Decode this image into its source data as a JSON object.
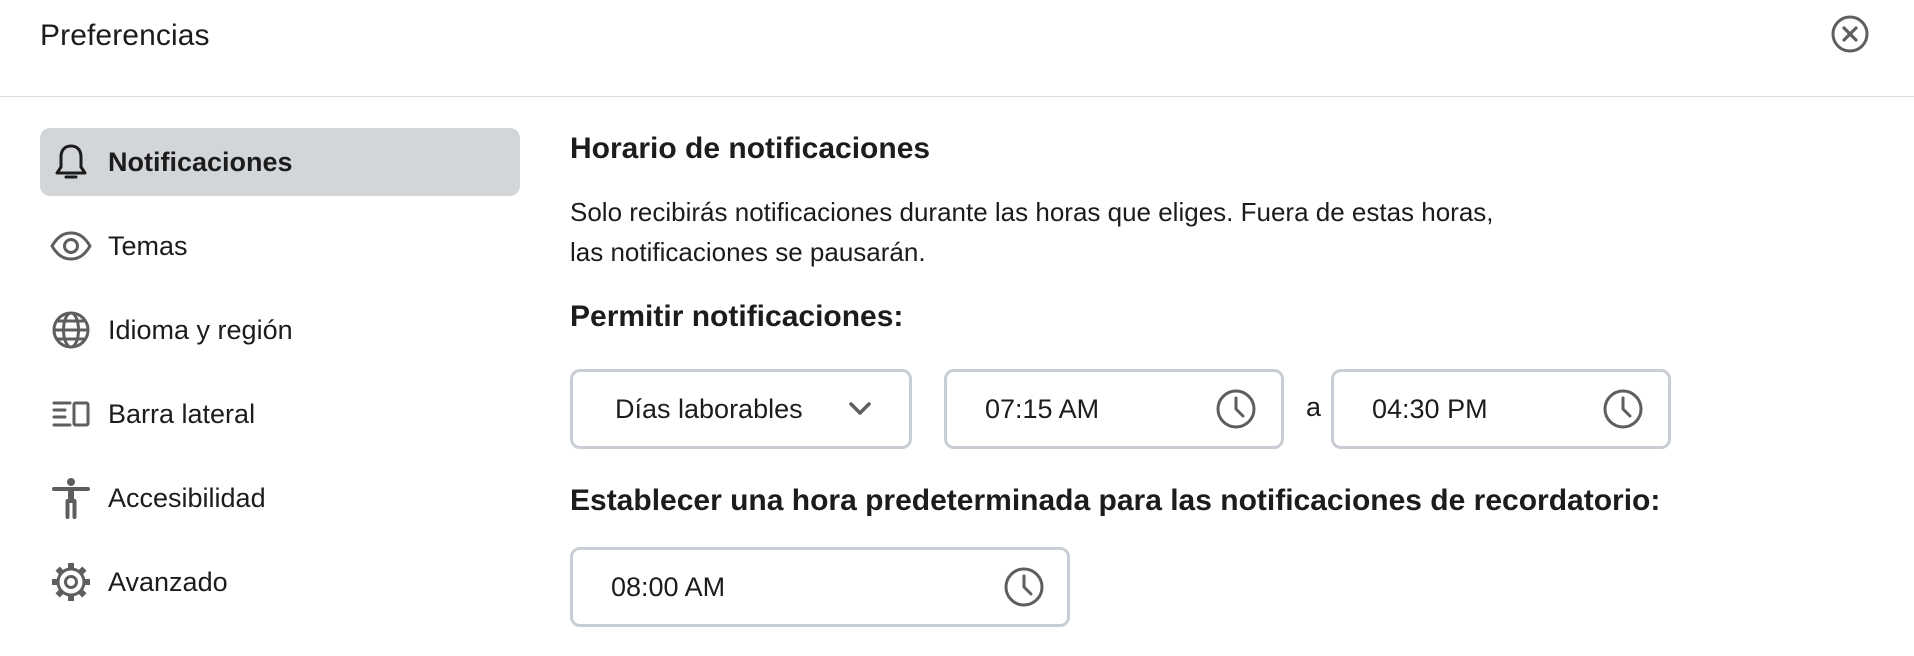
{
  "header": {
    "title": "Preferencias",
    "close_icon": "close-circle-icon"
  },
  "sidebar": {
    "items": [
      {
        "label": "Notificaciones",
        "icon": "bell-icon",
        "active": true
      },
      {
        "label": "Temas",
        "icon": "eye-icon",
        "active": false
      },
      {
        "label": "Idioma y región",
        "icon": "globe-icon",
        "active": false
      },
      {
        "label": "Barra lateral",
        "icon": "sidebar-icon",
        "active": false
      },
      {
        "label": "Accesibilidad",
        "icon": "accessibility-icon",
        "active": false
      },
      {
        "label": "Avanzado",
        "icon": "gear-icon",
        "active": false
      }
    ]
  },
  "main": {
    "section_title": "Horario de notificaciones",
    "description": "Solo recibirás notificaciones durante las horas que eliges. Fuera de estas horas, las notificaciones se pausarán.",
    "allow_label": "Permitir notificaciones:",
    "days_select": {
      "value": "Días laborables",
      "icon": "chevron-down-icon"
    },
    "start_time": {
      "value": "07:15 AM",
      "icon": "clock-icon"
    },
    "to_label": "a",
    "end_time": {
      "value": "04:30 PM",
      "icon": "clock-icon"
    },
    "reminder_label": "Establecer una hora predeterminada para las notificaciones de recordatorio:",
    "reminder_time": {
      "value": "08:00 AM",
      "icon": "clock-icon"
    }
  },
  "colors": {
    "active_bg": "#d3d6d9",
    "border": "#c8ced3",
    "text": "#1d1c1d",
    "icon": "#5e5e5e"
  }
}
